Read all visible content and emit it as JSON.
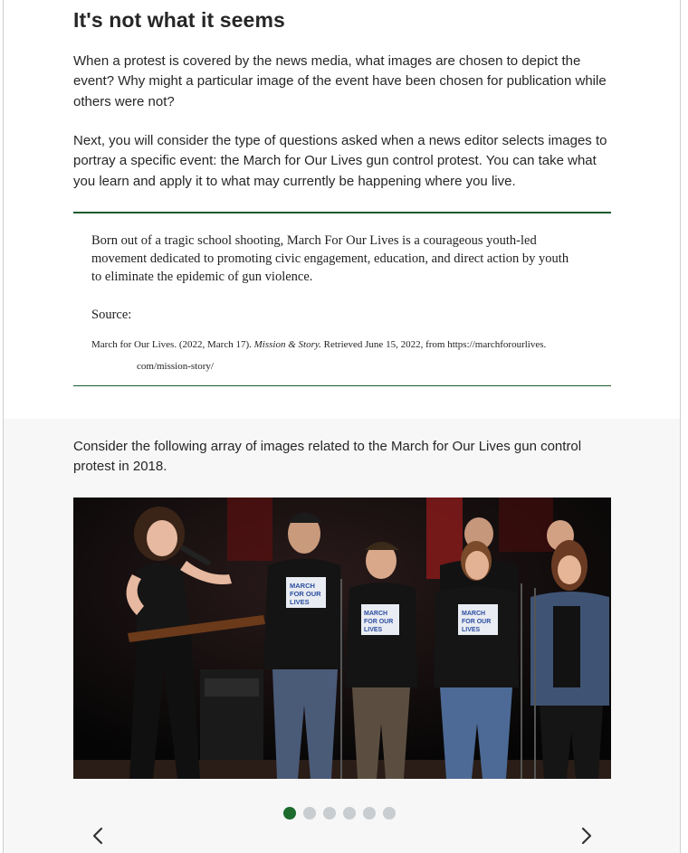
{
  "heading": "It's not what it seems",
  "intro": {
    "p1": "When a protest is covered by the news media, what images are chosen to depict the event? Why might a particular image of the event have been chosen for publication while others were not?",
    "p2": "Next, you will consider the type of questions asked when a news editor selects images to portray a specific event: the March for Our Lives gun control protest. You can take what you learn and apply it to what may currently be happening where you live."
  },
  "quote": {
    "text": "Born out of a tragic school shooting, March For Our Lives is a courageous youth-led movement dedicated to promoting civic engagement, education, and direct action by youth to eliminate the epidemic of gun violence.",
    "source_label": "Source:",
    "citation_start": "March for Our Lives. (2022, March 17). ",
    "citation_title": "Mission & Story.",
    "citation_end": " Retrieved June 15, 2022, from https://marchforourlives.",
    "citation_cont": "com/mission-story/"
  },
  "gallery": {
    "intro": "Consider the following array of images related to the March for Our Lives gun control protest in 2018.",
    "shirt_text": "MARCH FOR OUR LIVES",
    "total_slides": 6,
    "active_slide": 1
  },
  "colors": {
    "accent": "#1e5a2d",
    "dot_active": "#1e6b2e",
    "dot_inactive": "#c8cdd1",
    "section_bg": "#f7f7f7"
  },
  "icons": {
    "prev": "chevron-left-icon",
    "next": "chevron-right-icon"
  }
}
